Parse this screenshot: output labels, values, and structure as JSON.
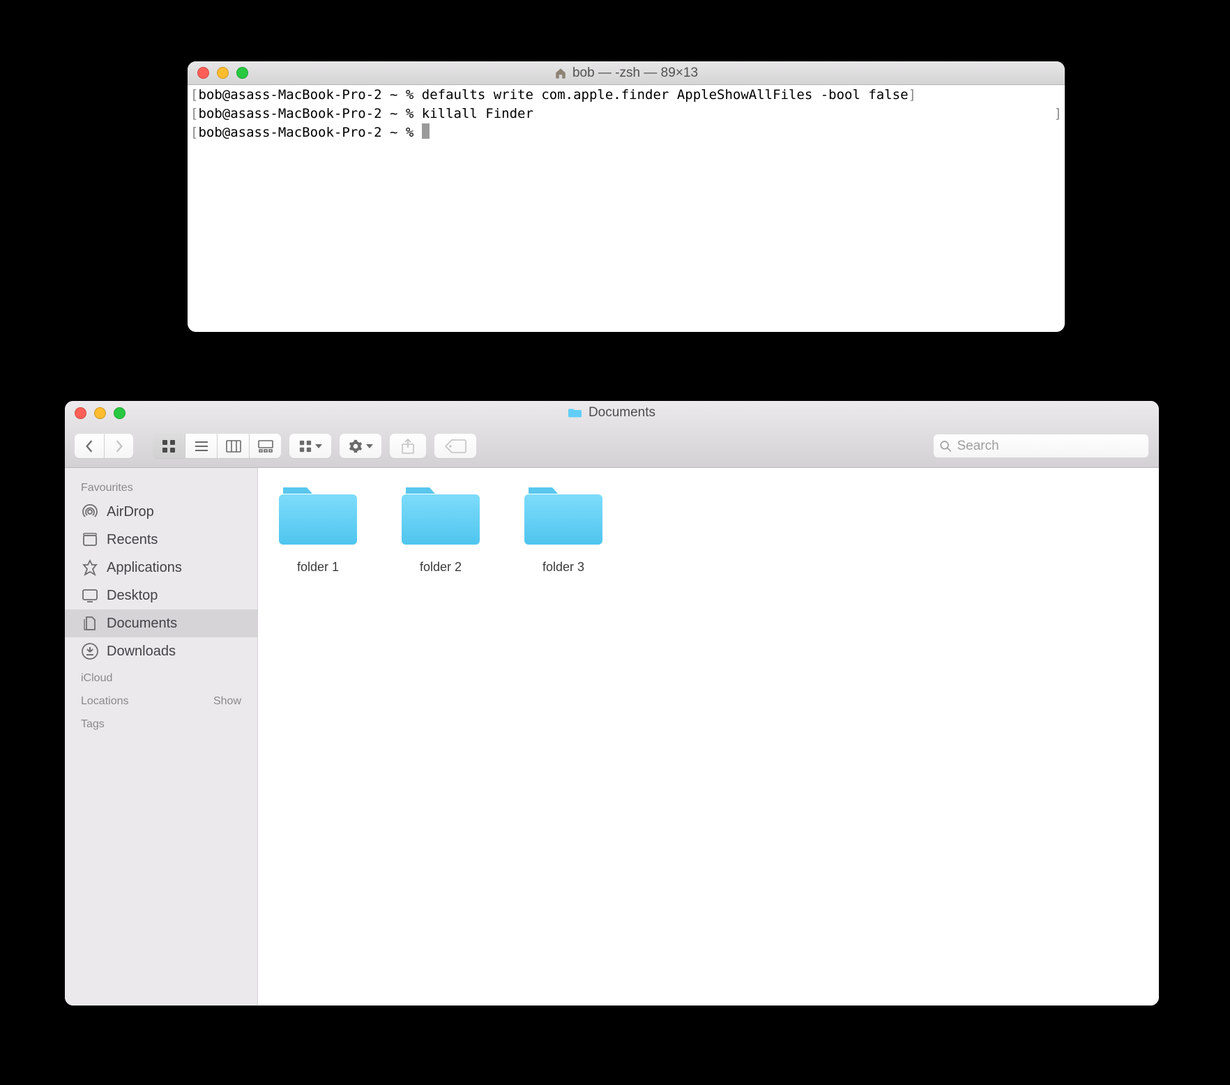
{
  "terminal": {
    "title": "bob — -zsh — 89×13",
    "prompt": "bob@asass-MacBook-Pro-2 ~ %",
    "lines": [
      {
        "cmd": "defaults write com.apple.finder AppleShowAllFiles -bool false"
      },
      {
        "cmd": "killall Finder"
      }
    ]
  },
  "finder": {
    "title": "Documents",
    "search_placeholder": "Search",
    "sidebar": {
      "sections": [
        {
          "label": "Favourites",
          "items": [
            {
              "id": "airdrop",
              "label": "AirDrop"
            },
            {
              "id": "recents",
              "label": "Recents"
            },
            {
              "id": "applications",
              "label": "Applications"
            },
            {
              "id": "desktop",
              "label": "Desktop"
            },
            {
              "id": "documents",
              "label": "Documents",
              "selected": true
            },
            {
              "id": "downloads",
              "label": "Downloads"
            }
          ]
        },
        {
          "label": "iCloud",
          "items": []
        },
        {
          "label": "Locations",
          "show_label": "Show",
          "items": []
        },
        {
          "label": "Tags",
          "items": []
        }
      ]
    },
    "folders": [
      {
        "name": "folder 1"
      },
      {
        "name": "folder 2"
      },
      {
        "name": "folder 3"
      }
    ]
  }
}
